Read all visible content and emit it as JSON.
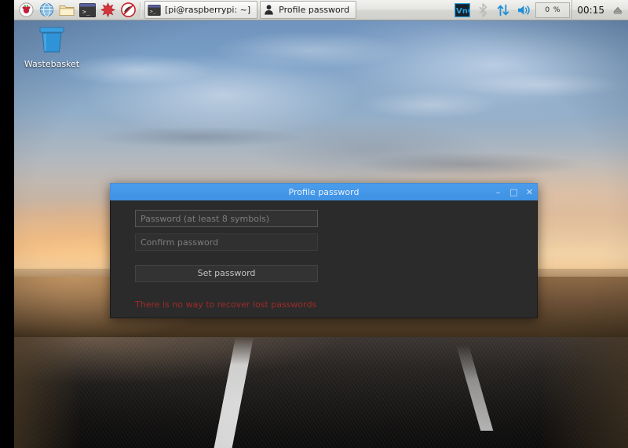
{
  "taskbar": {
    "launchers": [
      {
        "name": "raspberry-menu-icon",
        "title": "Menu"
      },
      {
        "name": "web-browser-icon",
        "title": "Web Browser"
      },
      {
        "name": "file-manager-icon",
        "title": "File Manager"
      },
      {
        "name": "terminal-icon",
        "title": "Terminal"
      },
      {
        "name": "mathematica-icon",
        "title": "Mathematica"
      },
      {
        "name": "wolfram-icon",
        "title": "Wolfram"
      }
    ],
    "windows": [
      {
        "label": "[pi@raspberrypi: ~]",
        "icon": "terminal-icon",
        "active": false
      },
      {
        "label": "Profile password",
        "icon": "lock-icon",
        "active": true
      }
    ],
    "tray": {
      "vnc_label": "VNC",
      "bluetooth_icon": "bluetooth-icon",
      "network_icon": "network-updown-icon",
      "volume_icon": "volume-icon",
      "cpu_label": "0 %",
      "clock": "00:15",
      "eject_icon": "eject-icon"
    }
  },
  "desktop": {
    "icons": [
      {
        "label": "Wastebasket",
        "icon": "wastebasket-icon"
      }
    ]
  },
  "dialog": {
    "title": "Profile password",
    "buttons": {
      "minimize": "–",
      "maximize": "□",
      "close": "✕"
    },
    "password_placeholder": "Password (at least 8 symbols)",
    "password_value": "",
    "confirm_placeholder": "Confirm password",
    "confirm_value": "",
    "submit_label": "Set password",
    "warning": "There is no way to recover lost passwords"
  },
  "colors": {
    "titlebar": "#4a9ceb",
    "dialog_bg": "#2b2b2b",
    "warning_text": "#a02a2a",
    "field_bg": "#303030",
    "taskbar_bg": "#e4e4e1"
  }
}
